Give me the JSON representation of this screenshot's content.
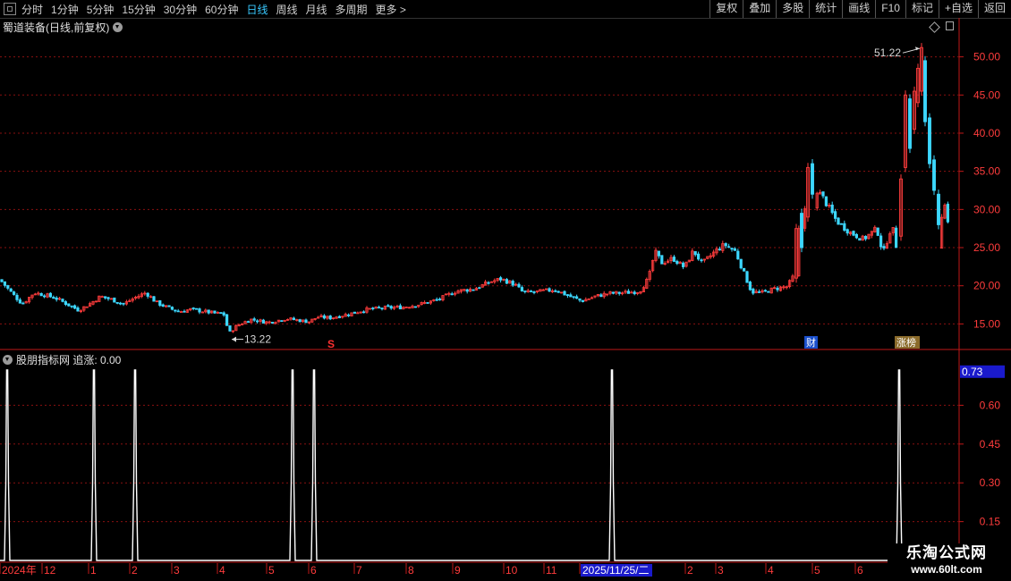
{
  "toolbar": {
    "periods": [
      "分时",
      "1分钟",
      "5分钟",
      "15分钟",
      "30分钟",
      "60分钟",
      "日线",
      "周线",
      "月线",
      "多周期",
      "更多 >"
    ],
    "active": "日线",
    "buttons": [
      "复权",
      "叠加",
      "多股",
      "统计",
      "画线",
      "F10",
      "标记",
      "+自选",
      "返回"
    ]
  },
  "chart_title": "蜀道装备(日线,前复权)",
  "indicator_title": "股朋指标网 追涨: 0.00",
  "markers": {
    "s": "S",
    "cai": "财",
    "zhangting": "涨榜"
  },
  "watermark": {
    "line1": "乐淘公式网",
    "line2": "www.60lt.com"
  },
  "colors": {
    "up": "#ff3c3c",
    "down": "#3cd7ff",
    "grid": "#8a1010",
    "indicator": "#ffffff",
    "axis_text": "#ff3c3c"
  },
  "chart_data": [
    {
      "type": "candlestick",
      "title": "蜀道装备(日线,前复权)",
      "y_ticks": [
        15.0,
        20.0,
        25.0,
        30.0,
        35.0,
        40.0,
        45.0,
        50.0
      ],
      "ylim": [
        12.0,
        53.0
      ],
      "annotations": [
        {
          "label": "51.22",
          "value": 51.22
        },
        {
          "label": "13.22",
          "value": 13.22
        }
      ],
      "x_labels": [
        "2024年",
        "12",
        "1",
        "2",
        "3",
        "4",
        "5",
        "6",
        "7",
        "8",
        "9",
        "10",
        "11",
        "2025/11/25/二",
        "2",
        "3",
        "4",
        "5",
        "6"
      ],
      "close_path": [
        [
          0,
          20.8
        ],
        [
          12,
          19.2
        ],
        [
          25,
          17.6
        ],
        [
          38,
          19.1
        ],
        [
          50,
          18.8
        ],
        [
          62,
          18.4
        ],
        [
          75,
          17.6
        ],
        [
          88,
          16.8
        ],
        [
          100,
          17.6
        ],
        [
          112,
          18.6
        ],
        [
          125,
          18.2
        ],
        [
          138,
          17.6
        ],
        [
          150,
          18.4
        ],
        [
          163,
          19.1
        ],
        [
          175,
          17.8
        ],
        [
          188,
          17.1
        ],
        [
          200,
          16.6
        ],
        [
          213,
          16.9
        ],
        [
          225,
          16.7
        ],
        [
          240,
          16.4
        ],
        [
          250,
          16.3
        ],
        [
          256,
          13.8
        ],
        [
          265,
          14.8
        ],
        [
          280,
          15.6
        ],
        [
          300,
          15.2
        ],
        [
          320,
          15.7
        ],
        [
          345,
          15.3
        ],
        [
          355,
          15.9
        ],
        [
          370,
          15.8
        ],
        [
          390,
          16.3
        ],
        [
          410,
          16.9
        ],
        [
          430,
          17.1
        ],
        [
          450,
          17.2
        ],
        [
          470,
          17.6
        ],
        [
          490,
          18.2
        ],
        [
          510,
          19.3
        ],
        [
          530,
          19.6
        ],
        [
          550,
          20.6
        ],
        [
          560,
          20.9
        ],
        [
          575,
          20.2
        ],
        [
          585,
          19.1
        ],
        [
          600,
          19.2
        ],
        [
          620,
          19.5
        ],
        [
          635,
          18.7
        ],
        [
          650,
          18.0
        ],
        [
          665,
          18.6
        ],
        [
          680,
          19.0
        ],
        [
          700,
          19.1
        ],
        [
          715,
          19.3
        ],
        [
          725,
          21.0
        ],
        [
          732,
          24.5
        ],
        [
          740,
          23.0
        ],
        [
          752,
          23.6
        ],
        [
          765,
          22.4
        ],
        [
          775,
          24.6
        ],
        [
          785,
          22.9
        ],
        [
          800,
          24.6
        ],
        [
          810,
          25.4
        ],
        [
          822,
          24.5
        ],
        [
          830,
          22.1
        ],
        [
          840,
          19.2
        ],
        [
          852,
          19.1
        ],
        [
          865,
          19.6
        ],
        [
          880,
          19.9
        ],
        [
          888,
          21.5
        ],
        [
          893,
          27.5
        ],
        [
          898,
          28.5
        ],
        [
          905,
          35.6
        ],
        [
          910,
          33.0
        ],
        [
          920,
          31.5
        ],
        [
          935,
          28.5
        ],
        [
          950,
          27.0
        ],
        [
          965,
          26.1
        ],
        [
          980,
          27.5
        ],
        [
          987,
          24.2
        ],
        [
          997,
          28.0
        ],
        [
          1002,
          25.0
        ],
        [
          1008,
          33.5
        ],
        [
          1013,
          44.5
        ],
        [
          1018,
          38.5
        ],
        [
          1024,
          43.5
        ],
        [
          1028,
          46.2
        ],
        [
          1031,
          51.0
        ],
        [
          1035,
          42.0
        ],
        [
          1040,
          36.5
        ],
        [
          1045,
          33.5
        ],
        [
          1050,
          28.5
        ],
        [
          1056,
          30.5
        ],
        [
          1062,
          27.2
        ]
      ],
      "big_moves": [
        [
          890,
          21.0,
          27.5,
          1
        ],
        [
          896,
          25.0,
          29.5,
          0
        ],
        [
          903,
          29.0,
          35.5,
          1
        ],
        [
          908,
          36.0,
          32.0,
          0
        ],
        [
          1007,
          26.5,
          34.0,
          1
        ],
        [
          1012,
          35.5,
          45.0,
          1
        ],
        [
          1017,
          44.5,
          38.0,
          0
        ],
        [
          1022,
          40.5,
          45.5,
          1
        ],
        [
          1026,
          44.0,
          48.5,
          1
        ],
        [
          1030,
          45.5,
          51.22,
          1
        ],
        [
          1034,
          49.5,
          41.5,
          0
        ],
        [
          1039,
          42.0,
          36.0,
          0
        ],
        [
          1044,
          36.5,
          32.5,
          0
        ],
        [
          1049,
          32.0,
          28.0,
          0
        ]
      ]
    },
    {
      "type": "line",
      "title": "股朋指标网 追涨: 0.00",
      "y_ticks": [
        0.15,
        0.3,
        0.45,
        0.6
      ],
      "highlight_tick": 0.73,
      "ylim": [
        0.0,
        0.75
      ],
      "spike_x": [
        8,
        105,
        151,
        327,
        351,
        684,
        1005
      ],
      "value": 0.0
    }
  ]
}
